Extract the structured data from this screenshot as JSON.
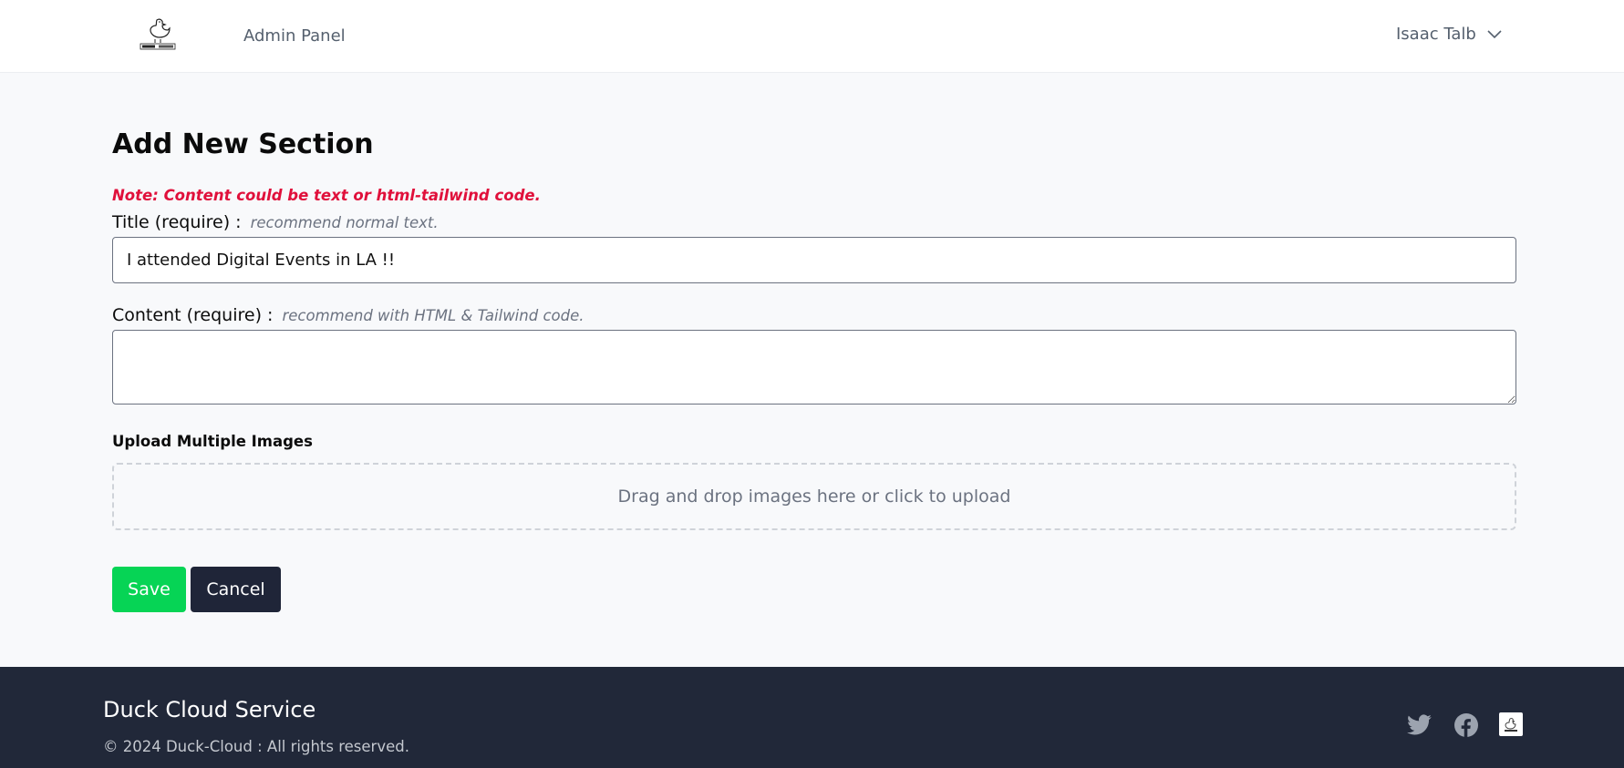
{
  "header": {
    "logo_icon": "duck-cloud-logo",
    "nav_link": "Admin Panel",
    "user_name": "Isaac Talb",
    "user_menu_icon": "chevron-down-icon"
  },
  "form": {
    "page_title": "Add New Section",
    "note": "Note: Content could be text or html-tailwind code.",
    "title_label": "Title (require) :",
    "title_hint": "recommend normal text.",
    "title_value": "I attended Digital Events in LA !!",
    "content_label": "Content (require) :",
    "content_hint": "recommend with HTML & Tailwind code.",
    "content_value": "",
    "upload_label": "Upload Multiple Images",
    "dropzone_text": "Drag and drop images here or click to upload",
    "save_label": "Save",
    "cancel_label": "Cancel"
  },
  "footer": {
    "title": "Duck Cloud Service",
    "copyright": "© 2024 Duck-Cloud : All rights reserved.",
    "social_icons": [
      "twitter-icon",
      "facebook-icon",
      "duck-cloud-logo"
    ]
  },
  "colors": {
    "note": "#e0103b",
    "save_button": "#06d455",
    "cancel_button": "#1f2538",
    "footer_bg": "#212839"
  }
}
